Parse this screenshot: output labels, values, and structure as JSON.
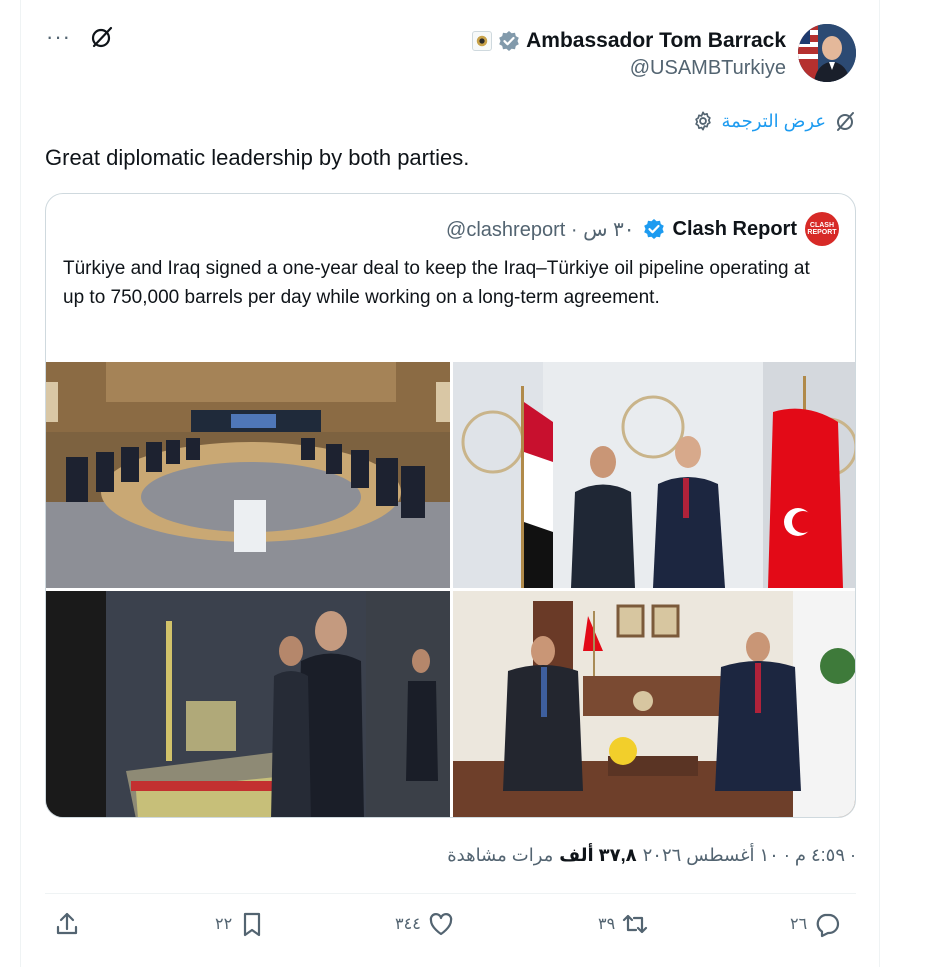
{
  "tweet": {
    "author_name": "Ambassador Tom Barrack",
    "author_handle": "@USAMBTurkiye",
    "translate_label": "عرض الترجمة",
    "text": "Great diplomatic leadership by both parties.",
    "more_label": "···"
  },
  "quote": {
    "name": "Clash Report",
    "handle_time": "@clashreport · ٣٠ س",
    "logo_line1": "CLASH",
    "logo_line2": "REPORT",
    "text": "Türkiye and Iraq signed a one-year deal to keep the Iraq–Türkiye oil pipeline operating at up to 750,000 barrels per day while working on a long-term agreement."
  },
  "meta": {
    "time_date": "٤:٥٩ م · ١٠ أغسطس ٢٠٢٦ ·",
    "views_count": "٣٧,٨ ألف",
    "views_label": "مرات مشاهدة"
  },
  "actions": {
    "share": "",
    "bookmarks": "٢٢",
    "likes": "٣٤٤",
    "retweets": "٣٩",
    "replies": "٢٦"
  },
  "colors": {
    "accent": "#1d9bf0",
    "text": "#0f1419",
    "muted": "#536471",
    "border": "#cfd9de",
    "clash_red": "#d72a27"
  },
  "icons": [
    "more-icon",
    "grok-icon",
    "verified-icon",
    "translate-icon",
    "settings-icon",
    "share-icon",
    "bookmark-icon",
    "like-icon",
    "retweet-icon",
    "reply-icon"
  ]
}
